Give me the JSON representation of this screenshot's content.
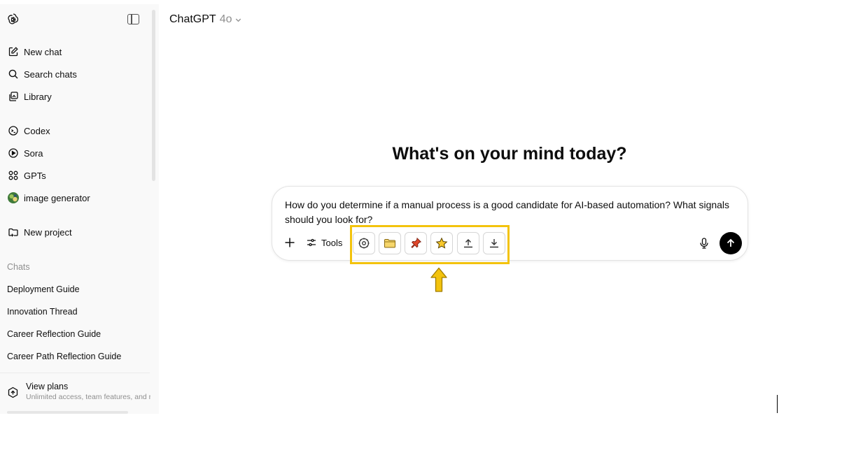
{
  "header": {
    "model_name": "ChatGPT",
    "model_version": "4o"
  },
  "sidebar": {
    "nav": [
      {
        "label": "New chat",
        "icon": "edit-icon"
      },
      {
        "label": "Search chats",
        "icon": "search-icon"
      },
      {
        "label": "Library",
        "icon": "library-icon"
      },
      {
        "label": "Codex",
        "icon": "codex-icon"
      },
      {
        "label": "Sora",
        "icon": "play-circle-icon"
      },
      {
        "label": "GPTs",
        "icon": "grid-icon"
      },
      {
        "label": "image generator",
        "icon": "gpt-avatar-icon"
      },
      {
        "label": "New project",
        "icon": "folder-plus-icon"
      }
    ],
    "chats_label": "Chats",
    "chats": [
      "Deployment Guide",
      "Innovation Thread",
      "Career Reflection Guide",
      "Career Path Reflection Guide"
    ],
    "plans": {
      "title": "View plans",
      "subtitle": "Unlimited access, team features, and more"
    }
  },
  "main": {
    "heading": "What's on your mind today?",
    "prompt": "How do you determine if a manual process is a good candidate for AI-based automation? What signals should you look for?",
    "tools_label": "Tools",
    "toolbar_icons": [
      "settings-gear-icon",
      "folder-icon",
      "pin-icon",
      "star-icon",
      "upload-icon",
      "download-icon"
    ]
  },
  "colors": {
    "highlight": "#f3c30d",
    "arrow": "#f3c30d",
    "send_button": "#000000",
    "sidebar_bg": "#f9f9f9"
  }
}
